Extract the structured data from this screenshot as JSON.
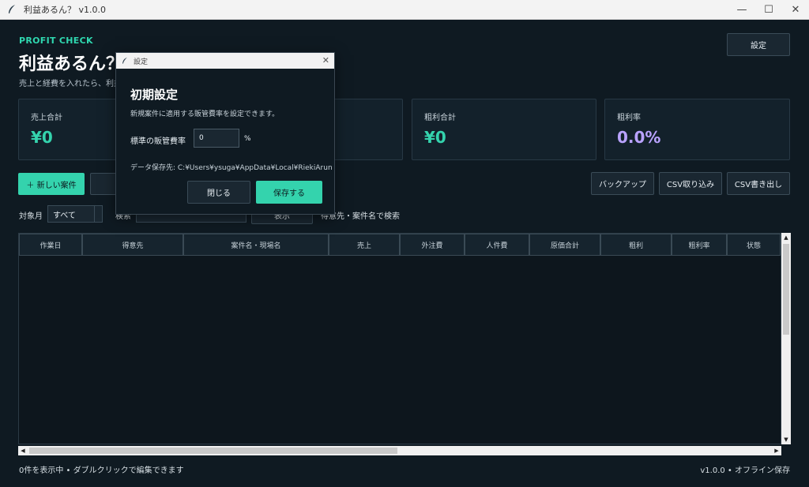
{
  "window": {
    "title": "利益あるん？  v1.0.0",
    "minimize": "—",
    "maximize": "☐",
    "close": "✕"
  },
  "header": {
    "brand": "PROFIT CHECK",
    "title": "利益あるん？",
    "subtitle": "売上と経費を入れたら、利益が",
    "settings_label": "設定"
  },
  "cards": [
    {
      "label": "売上合計",
      "value": "¥0"
    },
    {
      "label": "",
      "value": ""
    },
    {
      "label": "粗利合計",
      "value": "¥0"
    },
    {
      "label": "粗利率",
      "value": "0.0%"
    }
  ],
  "toolbar": {
    "new_case": "＋ 新しい案件",
    "backup": "バックアップ",
    "csv_import": "CSV取り込み",
    "csv_export": "CSV書き出し"
  },
  "filter": {
    "month_label": "対象月",
    "month_value": "すべて",
    "search_label": "検索",
    "search_button": "表示",
    "search_hint": "得意先・案件名で検索"
  },
  "table": {
    "columns": [
      "作業日",
      "得意先",
      "案件名・現場名",
      "売上",
      "外注費",
      "人件費",
      "原価合計",
      "粗利",
      "粗利率",
      "状態"
    ],
    "rows": []
  },
  "footer": {
    "left": "0件を表示中  •  ダブルクリックで編集できます",
    "right": "v1.0.0  •  オフライン保存"
  },
  "dialog": {
    "title": "設定",
    "close": "✕",
    "heading": "初期設定",
    "description": "新規案件に適用する販管費率を設定できます。",
    "rate_label": "標準の販管費率",
    "rate_value": "0",
    "rate_unit": "%",
    "path": "データ保存先: C:¥Users¥ysuga¥AppData¥Local¥RiekiArun",
    "close_button": "閉じる",
    "save_button": "保存する"
  },
  "colors": {
    "accent": "#34d3ad",
    "purple": "#b9a2ff",
    "background": "#0f1a22"
  }
}
